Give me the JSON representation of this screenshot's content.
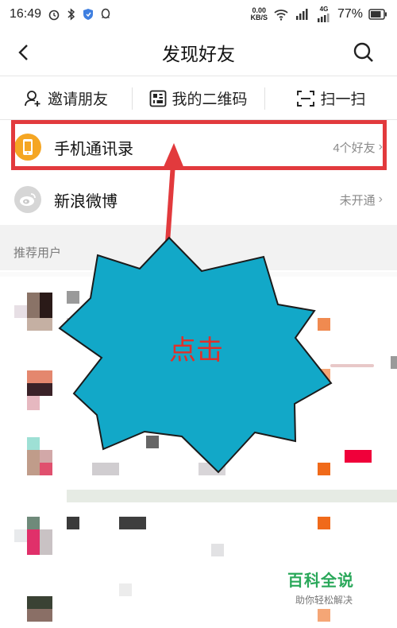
{
  "status_bar": {
    "time": "16:49",
    "net_speed_value": "0.00",
    "net_speed_unit": "KB/S",
    "network_type": "4G",
    "battery": "77%"
  },
  "nav": {
    "title": "发现好友"
  },
  "actions": [
    {
      "label": "邀请朋友",
      "icon": "add-user-icon"
    },
    {
      "label": "我的二维码",
      "icon": "qr-code-icon"
    },
    {
      "label": "扫一扫",
      "icon": "scan-icon"
    }
  ],
  "contacts_item": {
    "label": "手机通讯录",
    "meta": "4个好友",
    "icon": "phone-icon",
    "icon_color": "#f5a623"
  },
  "weibo_item": {
    "label": "新浪微博",
    "meta": "未开通",
    "icon": "weibo-icon",
    "icon_color": "#d9d9d9"
  },
  "recommended": {
    "header": "推荐用户"
  },
  "annotation": {
    "callout_text": "点击",
    "callout_color": "#12a8c8",
    "highlight_color": "#e23a3d"
  },
  "watermark": {
    "title": "百科全说",
    "subtitle": "助你轻松解决"
  }
}
